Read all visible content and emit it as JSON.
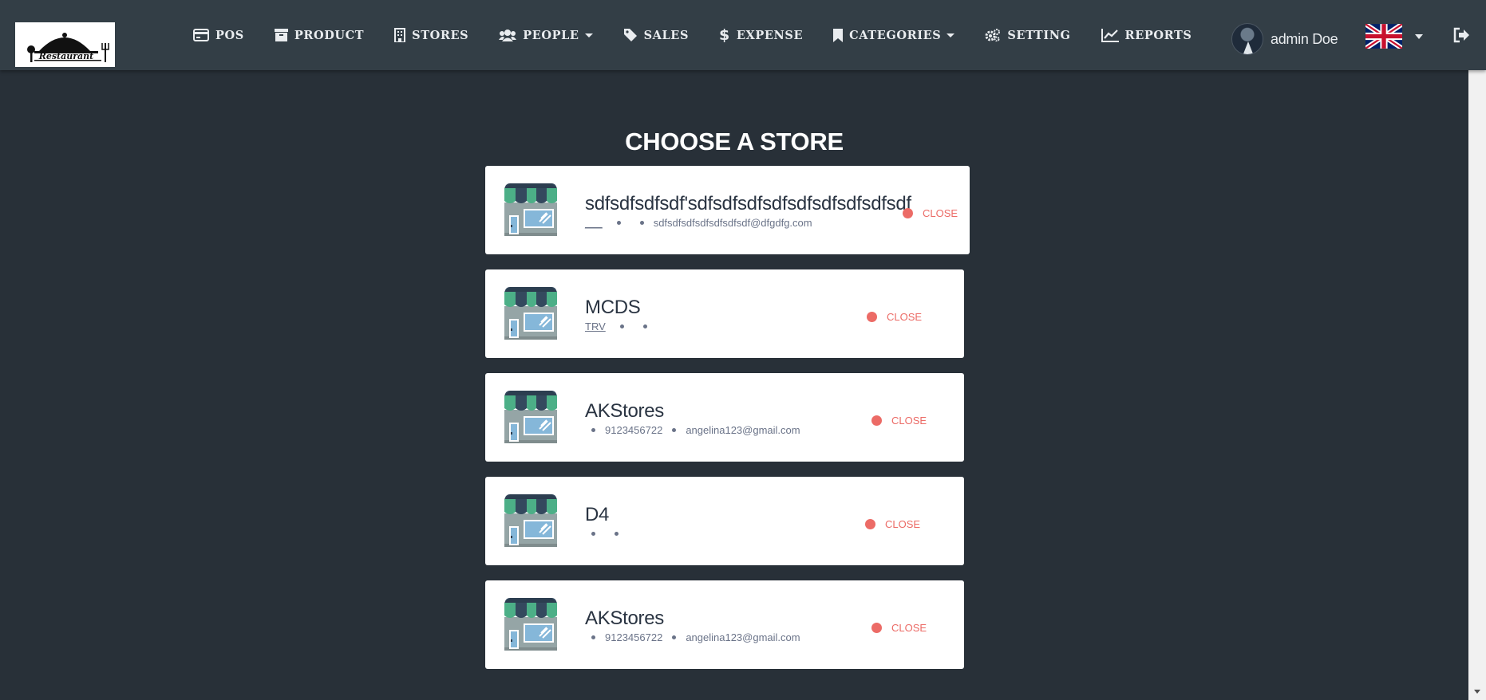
{
  "nav": {
    "logo_text": "Restaurant",
    "items": [
      {
        "label": "POS",
        "icon": "credit-card-icon"
      },
      {
        "label": "PRODUCT",
        "icon": "archive-box-icon"
      },
      {
        "label": "STORES",
        "icon": "building-icon"
      },
      {
        "label": "PEOPLE",
        "icon": "users-icon",
        "dropdown": true
      },
      {
        "label": "SALES",
        "icon": "tag-icon"
      },
      {
        "label": "EXPENSE",
        "icon": "dollar-icon"
      },
      {
        "label": "CATEGORIES",
        "icon": "bookmark-icon",
        "dropdown": true
      },
      {
        "label": "SETTING",
        "icon": "gears-icon"
      },
      {
        "label": "REPORTS",
        "icon": "line-chart-icon"
      }
    ],
    "user_name": "admin Doe",
    "language_flag": "uk-flag-icon"
  },
  "page": {
    "title": "CHOOSE A STORE"
  },
  "stores": [
    {
      "name": "sdfsdfsdfsdf'sdfsdfsdfsdfsdfsdfsdfsdfsdf",
      "code": "___",
      "phone": "",
      "email": "sdfsdfsdfsdfsdfsdfsdf@dfgdfg.com",
      "status": "CLOSE"
    },
    {
      "name": "MCDS",
      "code": "TRV",
      "phone": "",
      "email": "",
      "status": "CLOSE"
    },
    {
      "name": "AKStores",
      "code": "",
      "phone": "9123456722",
      "email": "angelina123@gmail.com",
      "status": "CLOSE"
    },
    {
      "name": "D4",
      "code": "",
      "phone": "",
      "email": "",
      "status": "CLOSE"
    },
    {
      "name": "AKStores",
      "code": "",
      "phone": "9123456722",
      "email": "angelina123@gmail.com",
      "status": "CLOSE"
    }
  ],
  "colors": {
    "background": "#283038",
    "navbar": "#333e46",
    "status_closed": "#ec6b66",
    "awning_green": "#4caf87",
    "awning_dark": "#34495e"
  }
}
